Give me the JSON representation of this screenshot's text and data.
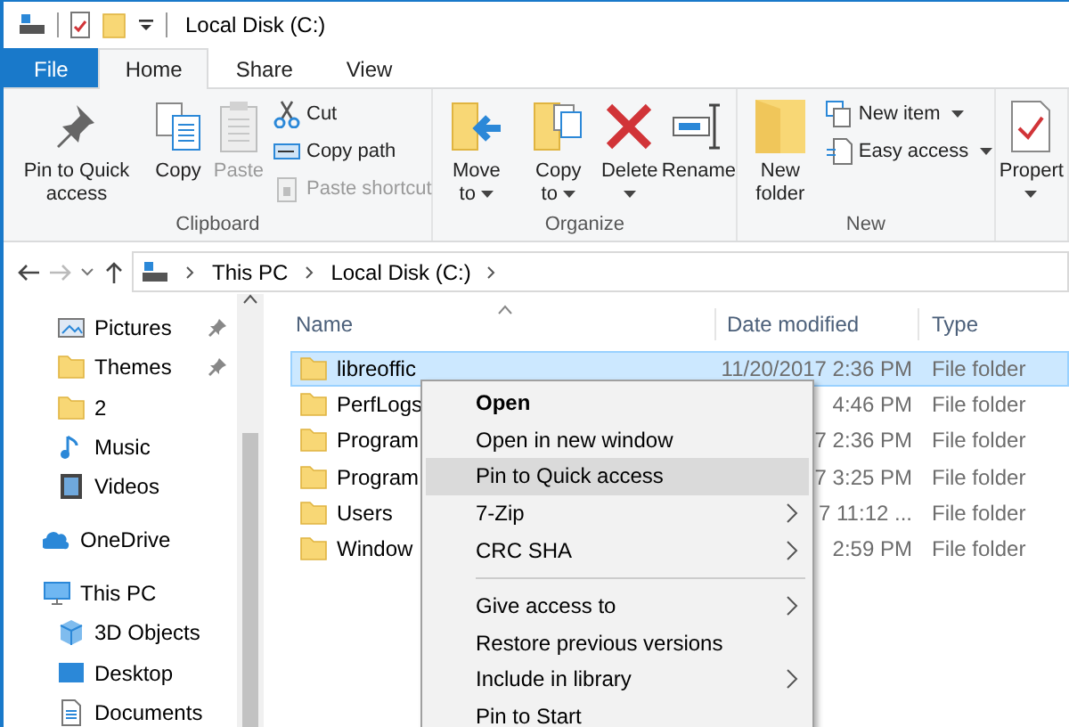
{
  "window": {
    "title": "Local Disk (C:)"
  },
  "tabs": [
    {
      "label": "File",
      "kind": "file",
      "selected": false
    },
    {
      "label": "Home",
      "kind": "tab",
      "selected": true
    },
    {
      "label": "Share",
      "kind": "tab",
      "selected": false
    },
    {
      "label": "View",
      "kind": "tab",
      "selected": false
    }
  ],
  "ribbon": {
    "groups": [
      {
        "label": "Clipboard",
        "items": [
          {
            "label": "Pin to Quick access",
            "kind": "large",
            "disabled": false,
            "dropdown": false
          },
          {
            "label": "Copy",
            "kind": "large",
            "disabled": false,
            "dropdown": false
          },
          {
            "label": "Paste",
            "kind": "large",
            "disabled": true,
            "dropdown": false
          },
          {
            "label": "Cut",
            "kind": "small",
            "disabled": false,
            "dropdown": false
          },
          {
            "label": "Copy path",
            "kind": "small",
            "disabled": false,
            "dropdown": false
          },
          {
            "label": "Paste shortcut",
            "kind": "small",
            "disabled": true,
            "dropdown": false
          }
        ]
      },
      {
        "label": "Organize",
        "items": [
          {
            "label": "Move to",
            "kind": "large",
            "disabled": false,
            "dropdown": true
          },
          {
            "label": "Copy to",
            "kind": "large",
            "disabled": false,
            "dropdown": true
          },
          {
            "label": "Delete",
            "kind": "large",
            "disabled": false,
            "dropdown": true
          },
          {
            "label": "Rename",
            "kind": "large",
            "disabled": false,
            "dropdown": false
          }
        ]
      },
      {
        "label": "New",
        "items": [
          {
            "label": "New folder",
            "kind": "large",
            "disabled": false,
            "dropdown": false
          },
          {
            "label": "New item",
            "kind": "small",
            "disabled": false,
            "dropdown": true
          },
          {
            "label": "Easy access",
            "kind": "small",
            "disabled": false,
            "dropdown": true
          }
        ]
      },
      {
        "items": [
          {
            "label": "Propert",
            "kind": "large",
            "disabled": false,
            "dropdown": true
          }
        ]
      }
    ]
  },
  "address": {
    "crumbs": [
      "This PC",
      "Local Disk (C:)"
    ]
  },
  "sidebar": {
    "quick_access": [
      {
        "label": "Pictures",
        "pinned": true
      },
      {
        "label": "Themes",
        "pinned": true
      },
      {
        "label": "2",
        "pinned": false
      },
      {
        "label": "Music",
        "pinned": false
      },
      {
        "label": "Videos",
        "pinned": false
      }
    ],
    "roots": [
      {
        "label": "OneDrive"
      },
      {
        "label": "This PC",
        "children": [
          {
            "label": "3D Objects"
          },
          {
            "label": "Desktop"
          },
          {
            "label": "Documents"
          }
        ]
      }
    ]
  },
  "table": {
    "columns": [
      "Name",
      "Date modified",
      "Type"
    ],
    "rows": [
      {
        "name": "libreoffic",
        "date": "11/20/2017 2:36 PM",
        "type": "File folder",
        "selected": true
      },
      {
        "name": "PerfLogs",
        "date": "4:46 PM",
        "type": "File folder",
        "selected": false
      },
      {
        "name": "Program",
        "date": "7 2:36 PM",
        "type": "File folder",
        "selected": false
      },
      {
        "name": "Program",
        "date": "7 3:25 PM",
        "type": "File folder",
        "selected": false
      },
      {
        "name": "Users",
        "date": "7 11:12 ...",
        "type": "File folder",
        "selected": false
      },
      {
        "name": "Window",
        "date": "2:59 PM",
        "type": "File folder",
        "selected": false
      }
    ]
  },
  "context_menu": {
    "groups": [
      [
        {
          "label": "Open",
          "default": true,
          "submenu": false,
          "selected": false
        },
        {
          "label": "Open in new window",
          "default": false,
          "submenu": false,
          "selected": false
        },
        {
          "label": "Pin to Quick access",
          "default": false,
          "submenu": false,
          "selected": true
        },
        {
          "label": "7-Zip",
          "default": false,
          "submenu": true,
          "selected": false
        },
        {
          "label": "CRC SHA",
          "default": false,
          "submenu": true,
          "selected": false
        }
      ],
      [
        {
          "label": "Give access to",
          "default": false,
          "submenu": true,
          "selected": false
        },
        {
          "label": "Restore previous versions",
          "default": false,
          "submenu": false,
          "selected": false
        },
        {
          "label": "Include in library",
          "default": false,
          "submenu": true,
          "selected": false
        },
        {
          "label": "Pin to Start",
          "default": false,
          "submenu": false,
          "selected": false
        }
      ]
    ]
  }
}
